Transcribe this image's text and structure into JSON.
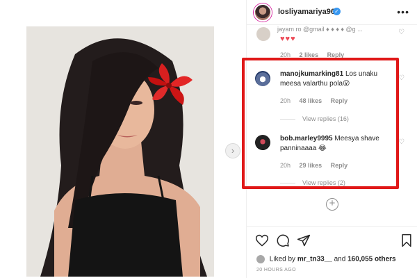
{
  "post": {
    "image_alt": "woman with red flower in hair, black top"
  },
  "header": {
    "username": "losliyamariya96",
    "more_label": "•••"
  },
  "comments": {
    "partial": {
      "text": "jayam ro @gmail  ♦ ♦ ♦ ♦ @g ..."
    },
    "hearts": "♥♥♥",
    "first_meta": {
      "time": "20h",
      "likes": "2 likes",
      "reply": "Reply"
    },
    "items": [
      {
        "username": "manojkumarking81",
        "text": "Los unaku meesa valarthu pola😮",
        "time": "20h",
        "likes": "48 likes",
        "reply": "Reply",
        "view_replies": "View replies (16)"
      },
      {
        "username": "bob.marley9995",
        "text": "Meesya shave panninaaaa 😂",
        "time": "20h",
        "likes": "29 likes",
        "reply": "Reply",
        "view_replies": "View replies (2)"
      }
    ],
    "add_label": "+"
  },
  "footer": {
    "liked_by_prefix": "Liked by",
    "liked_by_user": "mr_tn33__",
    "liked_by_mid": "and",
    "liked_by_count": "160,055 others",
    "time_ago": "20 HOURS AGO"
  },
  "colors": {
    "highlight": "#e01818",
    "heart": "#ed4956",
    "verified": "#3897f0"
  },
  "icons": [
    "heart-icon",
    "comment-icon",
    "share-icon",
    "bookmark-icon",
    "verified-icon",
    "plus-circle-icon",
    "chevron-right-icon"
  ]
}
